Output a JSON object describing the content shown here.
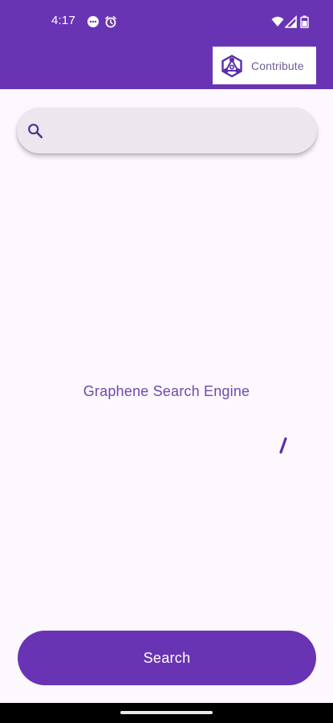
{
  "status_bar": {
    "time": "4:17",
    "left_icons": [
      "message-icon",
      "alarm-icon"
    ],
    "right_icons": [
      "wifi-icon",
      "signal-icon",
      "battery-icon"
    ]
  },
  "header": {
    "contribute_label": "Contribute",
    "logo_icon": "graphene-logo-icon"
  },
  "search": {
    "value": "",
    "icon": "search-icon"
  },
  "main": {
    "title": "Graphene Search Engine"
  },
  "actions": {
    "search_label": "Search"
  },
  "colors": {
    "primary": "#6934b3",
    "background": "#fdf7fe",
    "search_field": "#ece6ef",
    "title_text": "#6c4ca8",
    "contribute_text": "#6e5d94"
  }
}
